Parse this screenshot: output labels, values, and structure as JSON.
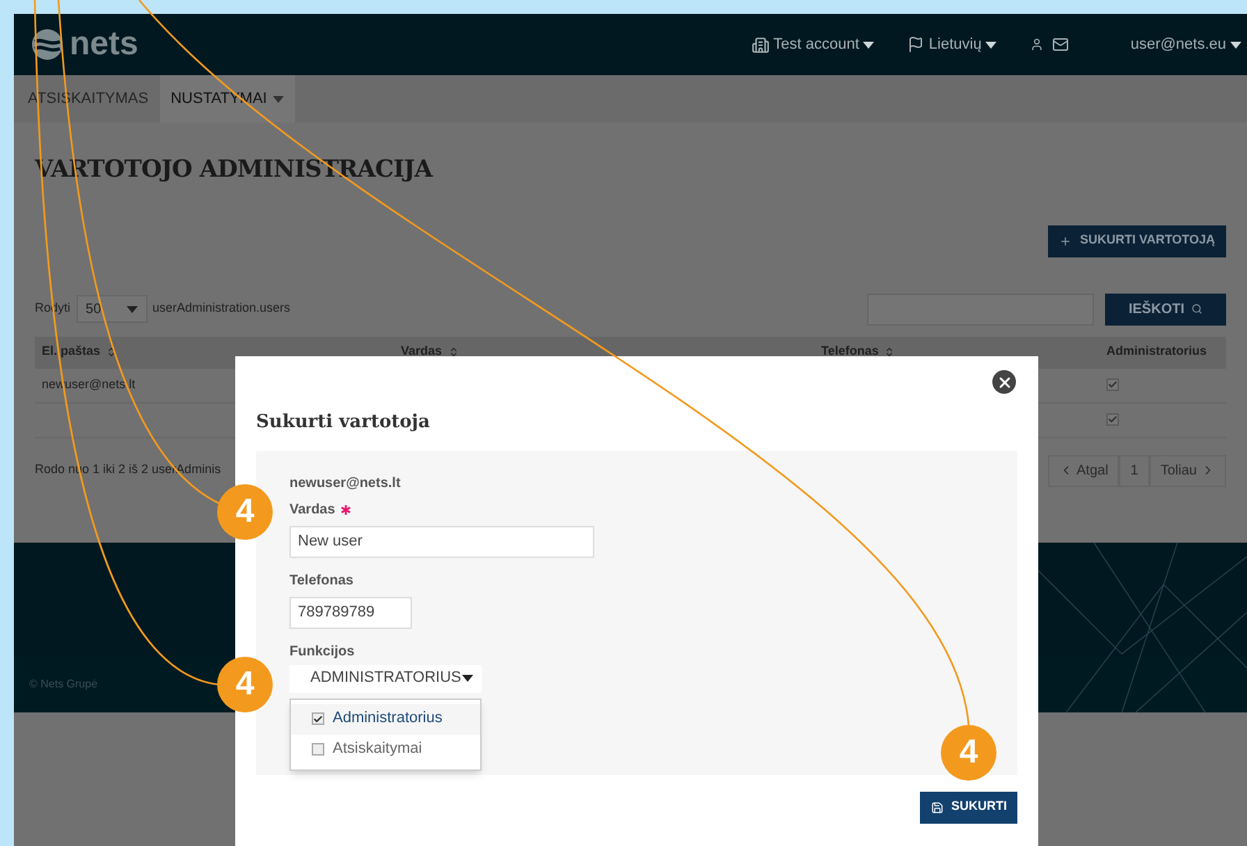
{
  "header": {
    "logo": "nets",
    "account": "Test account",
    "language": "Lietuvių",
    "user": "user@nets.eu"
  },
  "nav_tabs": [
    {
      "label": "ATSISKAITYMAS",
      "selected": false,
      "dropdown": false
    },
    {
      "label": "NUSTATYMAI",
      "selected": true,
      "dropdown": true
    }
  ],
  "page_title": "VARTOTOJO ADMINISTRACIJA",
  "create_button": "SUKURTI VARTOTOJĄ",
  "toolbar": {
    "show_label": "Rodyti",
    "page_size": "50",
    "entries_label": "userAdministration.users",
    "search_button": "IEŠKOTI"
  },
  "table": {
    "columns": [
      {
        "label": "El. paštas",
        "sortable": true
      },
      {
        "label": "Vardas",
        "sortable": true
      },
      {
        "label": "Telefonas",
        "sortable": true
      },
      {
        "label": "Administratorius",
        "sortable": false
      }
    ],
    "rows": [
      {
        "email": "newuser@nets.lt",
        "admin": true
      },
      {
        "admin": true
      }
    ]
  },
  "info": "Rodo nuo 1 iki 2 iš 2 userAdminis",
  "pagination": [
    {
      "label": "Atgal",
      "kind": "prev"
    },
    {
      "label": "1",
      "kind": "page"
    },
    {
      "label": "Toliau",
      "kind": "next"
    }
  ],
  "footer": {
    "copyright": "© Nets Grupė"
  },
  "modal": {
    "title": "Sukurti vartotoja",
    "email": "newuser@nets.lt",
    "fields": [
      {
        "label": "Vardas",
        "required": true,
        "value": "New user"
      },
      {
        "label": "Telefonas",
        "required": false,
        "value": "789789789"
      }
    ],
    "functions": {
      "label": "Funkcijos",
      "value": "ADMINISTRATORIUS",
      "expanded": true,
      "options": [
        {
          "label": "Administratorius",
          "checked": true
        },
        {
          "label": "Atsiskaitymai",
          "checked": false
        }
      ]
    },
    "submit": "SUKURTI"
  },
  "callouts": [
    "4",
    "4",
    "4"
  ]
}
